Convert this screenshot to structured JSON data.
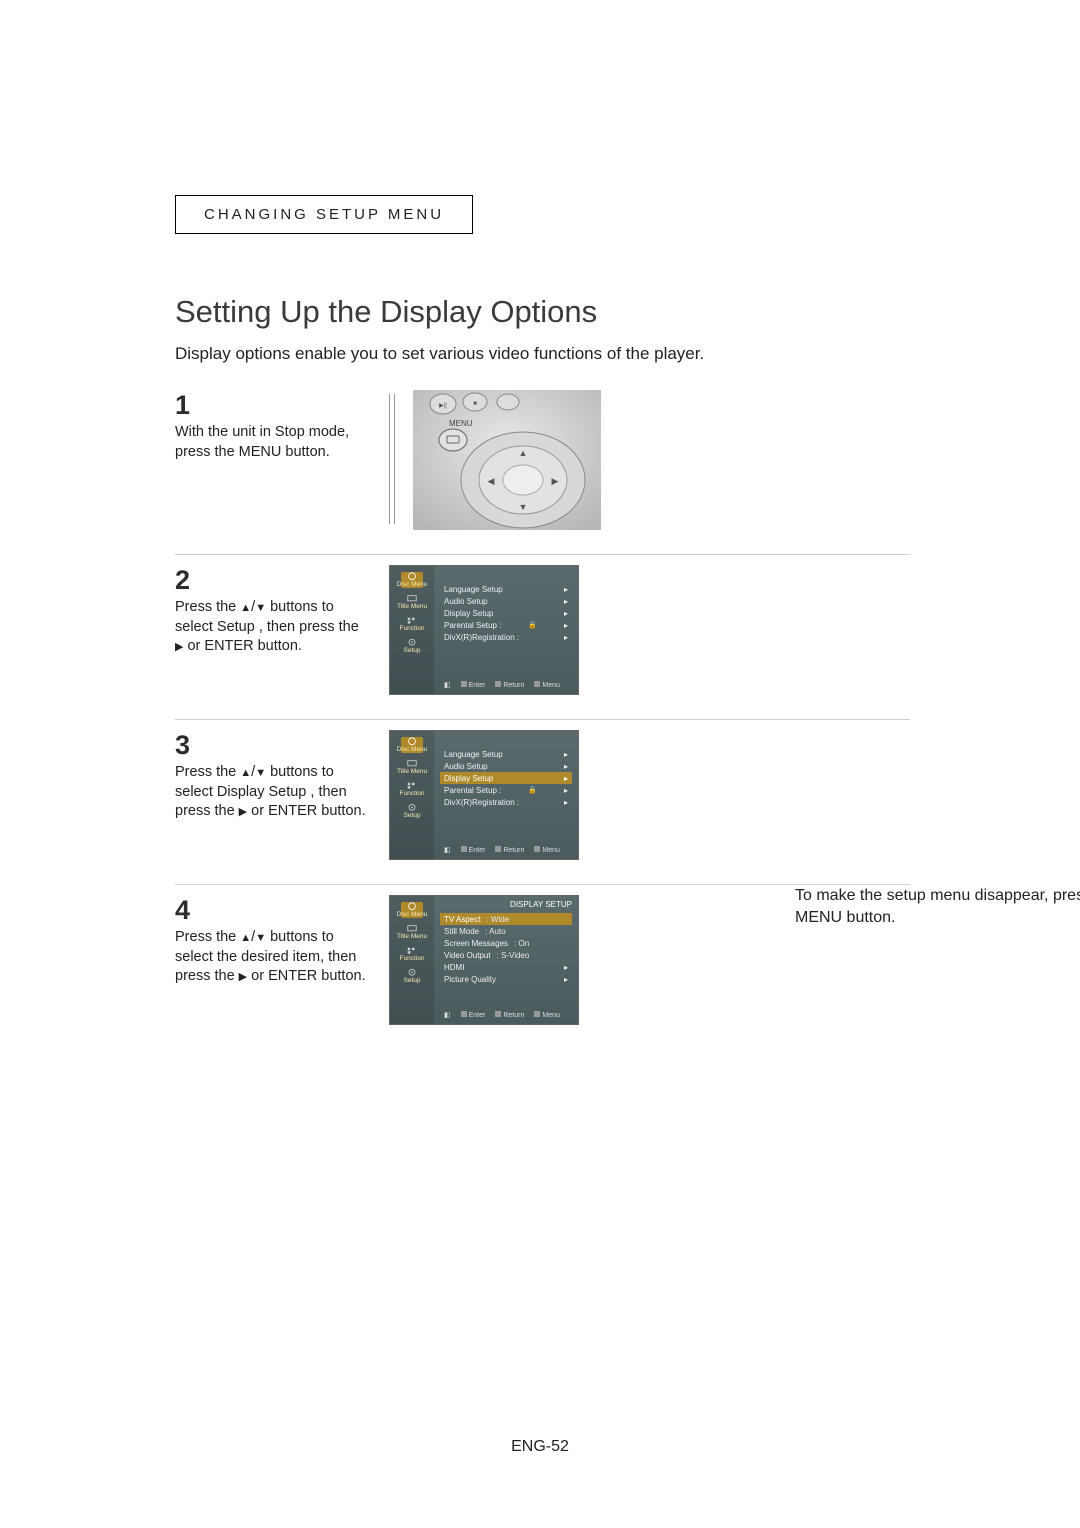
{
  "header": "CHANGING SETUP MENU",
  "title": "Setting Up the Display Options",
  "intro": "Display options enable you to set various video functions of the player.",
  "steps": {
    "s1": {
      "num": "1",
      "text": "With the unit in Stop mode, press the MENU button."
    },
    "s2": {
      "num": "2",
      "text_a": "Press the ",
      "text_b": " buttons to select Setup , then press the ",
      "text_c": " or ENTER button."
    },
    "s3": {
      "num": "3",
      "text_a": "Press the ",
      "text_b": " buttons to select Display Setup , then press the ",
      "text_c": " or ENTER button."
    },
    "s4": {
      "num": "4",
      "text_a": "Press the ",
      "text_b": " buttons to select the desired item, then press the ",
      "text_c": " or ENTER button."
    }
  },
  "sidebar": {
    "disc": "Disc Menu",
    "title": "Title Menu",
    "func": "Function",
    "setup": "Setup"
  },
  "menu_items": {
    "lang": "Language Setup",
    "audio": "Audio Setup",
    "display": "Display Setup",
    "parental": "Parental Setup :",
    "divx": "DivX(R)Registration :"
  },
  "display_setup": {
    "title": "DISPLAY SETUP",
    "tv_aspect": "TV Aspect",
    "tv_aspect_v": ": Wide",
    "still": "Still Mode",
    "still_v": ": Auto",
    "msgs": "Screen Messages",
    "msgs_v": ": On",
    "vout": "Video Output",
    "vout_v": ": S-Video",
    "hdmi": "HDMI",
    "pq": "Picture Quality"
  },
  "footer": {
    "enter": "Enter",
    "return": "Return",
    "menu": "Menu"
  },
  "remote": {
    "menu_label": "MENU"
  },
  "note": "To make the setup menu disappear, press the MENU button.",
  "page": "ENG-52"
}
